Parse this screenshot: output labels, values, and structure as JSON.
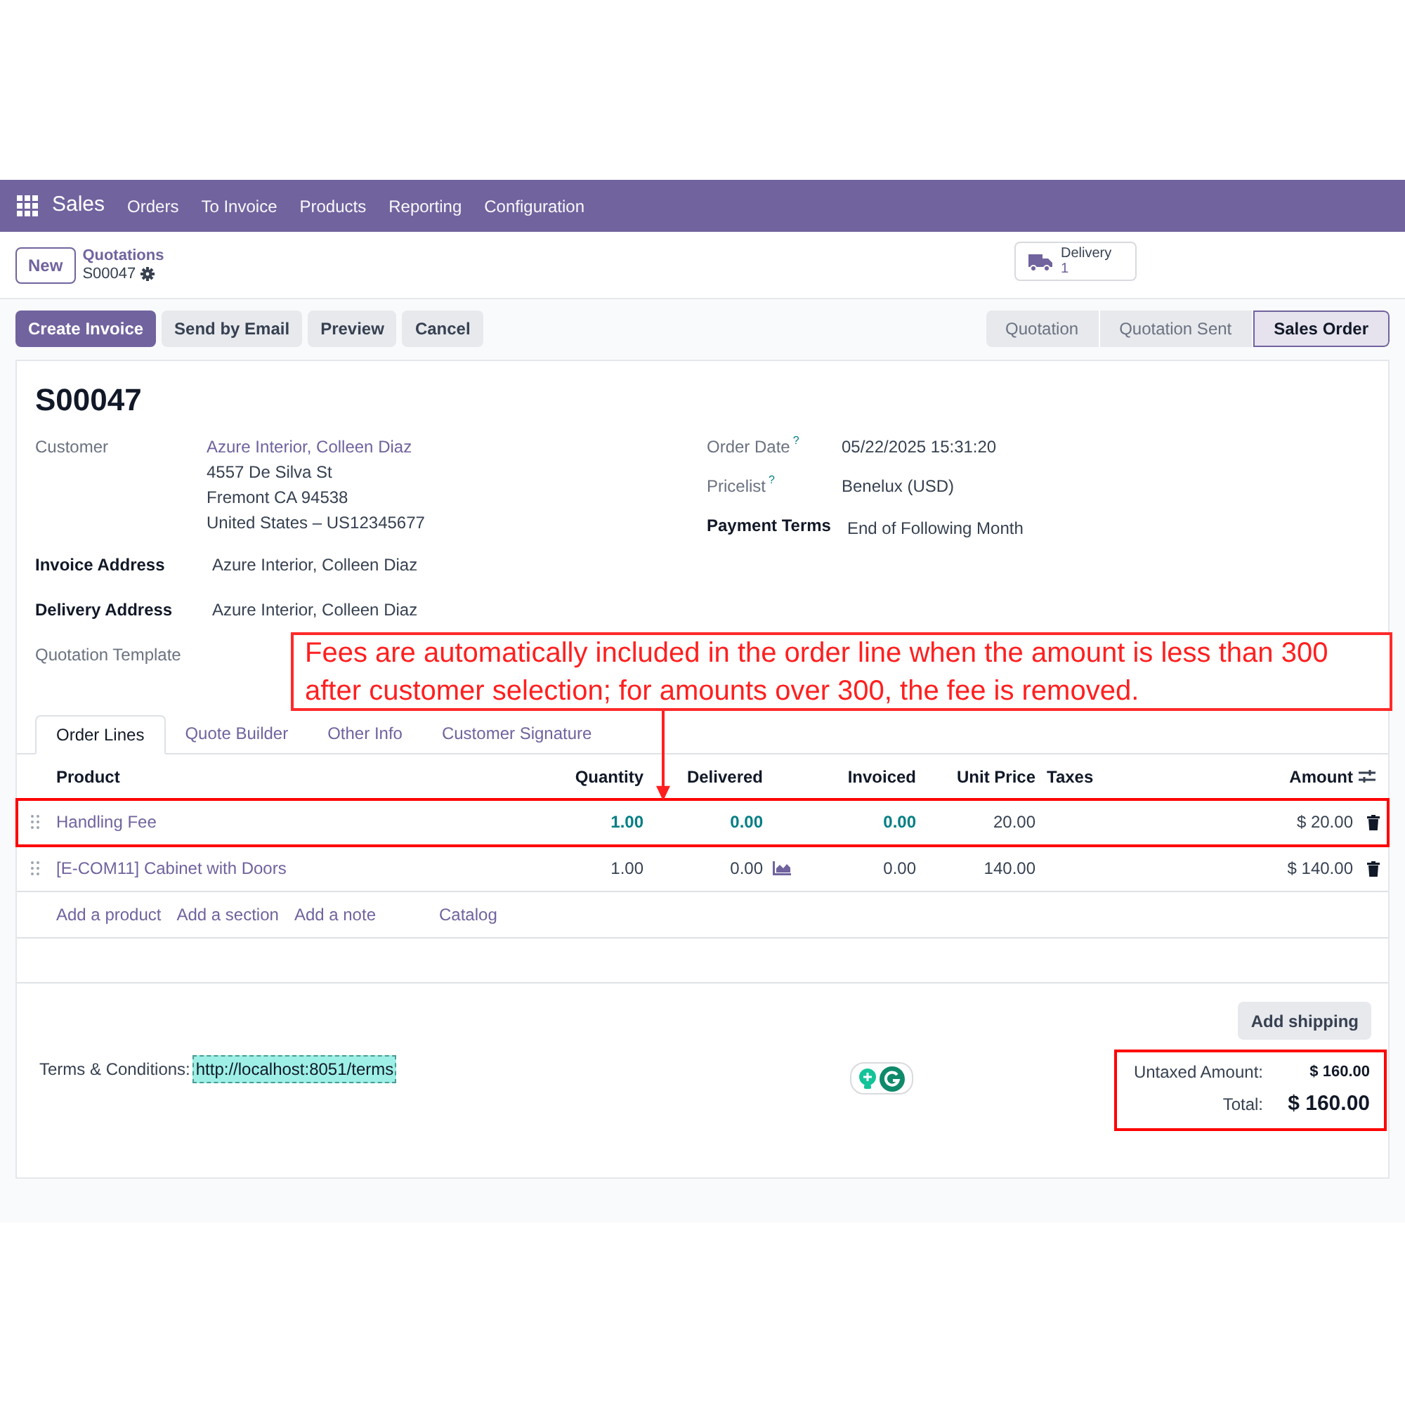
{
  "navbar": {
    "app": "Sales",
    "menu": [
      "Orders",
      "To Invoice",
      "Products",
      "Reporting",
      "Configuration"
    ]
  },
  "control_panel": {
    "new_button": "New",
    "breadcrumb": "Quotations",
    "record": "S00047",
    "smart_button": {
      "label": "Delivery",
      "count": "1"
    }
  },
  "actions": [
    {
      "label": "Create Invoice",
      "primary": true
    },
    {
      "label": "Send by Email",
      "primary": false
    },
    {
      "label": "Preview",
      "primary": false
    },
    {
      "label": "Cancel",
      "primary": false
    }
  ],
  "statusbar": [
    {
      "label": "Quotation",
      "selected": false
    },
    {
      "label": "Quotation Sent",
      "selected": false
    },
    {
      "label": "Sales Order",
      "selected": true
    }
  ],
  "form": {
    "title": "S00047",
    "left_fields": [
      {
        "label": "Customer",
        "bold": false,
        "lines": [
          "Azure Interior, Colleen Diaz",
          "4557 De Silva St",
          "Fremont CA 94538",
          "United States – US12345677"
        ]
      },
      {
        "label": "Invoice Address",
        "bold": true,
        "lines": [
          "Azure Interior, Colleen Diaz"
        ]
      },
      {
        "label": "Delivery Address",
        "bold": true,
        "lines": [
          "Azure Interior, Colleen Diaz"
        ]
      },
      {
        "label": "Quotation Template",
        "bold": false
      }
    ],
    "right_fields": [
      {
        "label": "Order Date",
        "help": "?",
        "bold": false,
        "value": "05/22/2025 15:31:20"
      },
      {
        "label": "Pricelist",
        "help": "?",
        "bold": false,
        "value": "Benelux (USD)"
      },
      {
        "label": "Payment Terms",
        "bold": true,
        "value": "End of Following Month"
      }
    ],
    "tabs": [
      {
        "label": "Order Lines",
        "selected": true
      },
      {
        "label": "Quote Builder",
        "selected": false
      },
      {
        "label": "Other Info",
        "selected": false
      },
      {
        "label": "Customer Signature",
        "selected": false
      }
    ],
    "table": {
      "columns": [
        "Product",
        "Quantity",
        "Delivered",
        "Invoiced",
        "Unit Price",
        "Taxes",
        "Amount"
      ],
      "rows": [
        {
          "product": "Handling Fee",
          "quantity": "1.00",
          "delivered": "0.00",
          "invoiced": "0.00",
          "unit_price": "20.00",
          "amount": "$ 20.00",
          "accented": true,
          "show_forecast": false,
          "highlighted": true
        },
        {
          "product": "[E-COM11] Cabinet with Doors",
          "quantity": "1.00",
          "delivered": "0.00",
          "invoiced": "0.00",
          "unit_price": "140.00",
          "amount": "$ 140.00",
          "accented": false,
          "show_forecast": true,
          "highlighted": false
        }
      ],
      "add_links": [
        "Add a product",
        "Add a section",
        "Add a note",
        "Catalog"
      ]
    },
    "add_shipping": "Add shipping",
    "terms_label": "Terms & Conditions:",
    "terms_link": "http://localhost:8051/terms",
    "totals": {
      "highlighted": true,
      "rows": [
        {
          "label": "Untaxed Amount:",
          "value": "$ 160.00",
          "kind": "subtotal"
        },
        {
          "label": "Total:",
          "value": "$ 160.00",
          "kind": "total"
        }
      ]
    }
  },
  "annotation": "Fees are automatically included in the order line when the amount is less than 300 after customer selection; for amounts over 300, the fee is removed."
}
